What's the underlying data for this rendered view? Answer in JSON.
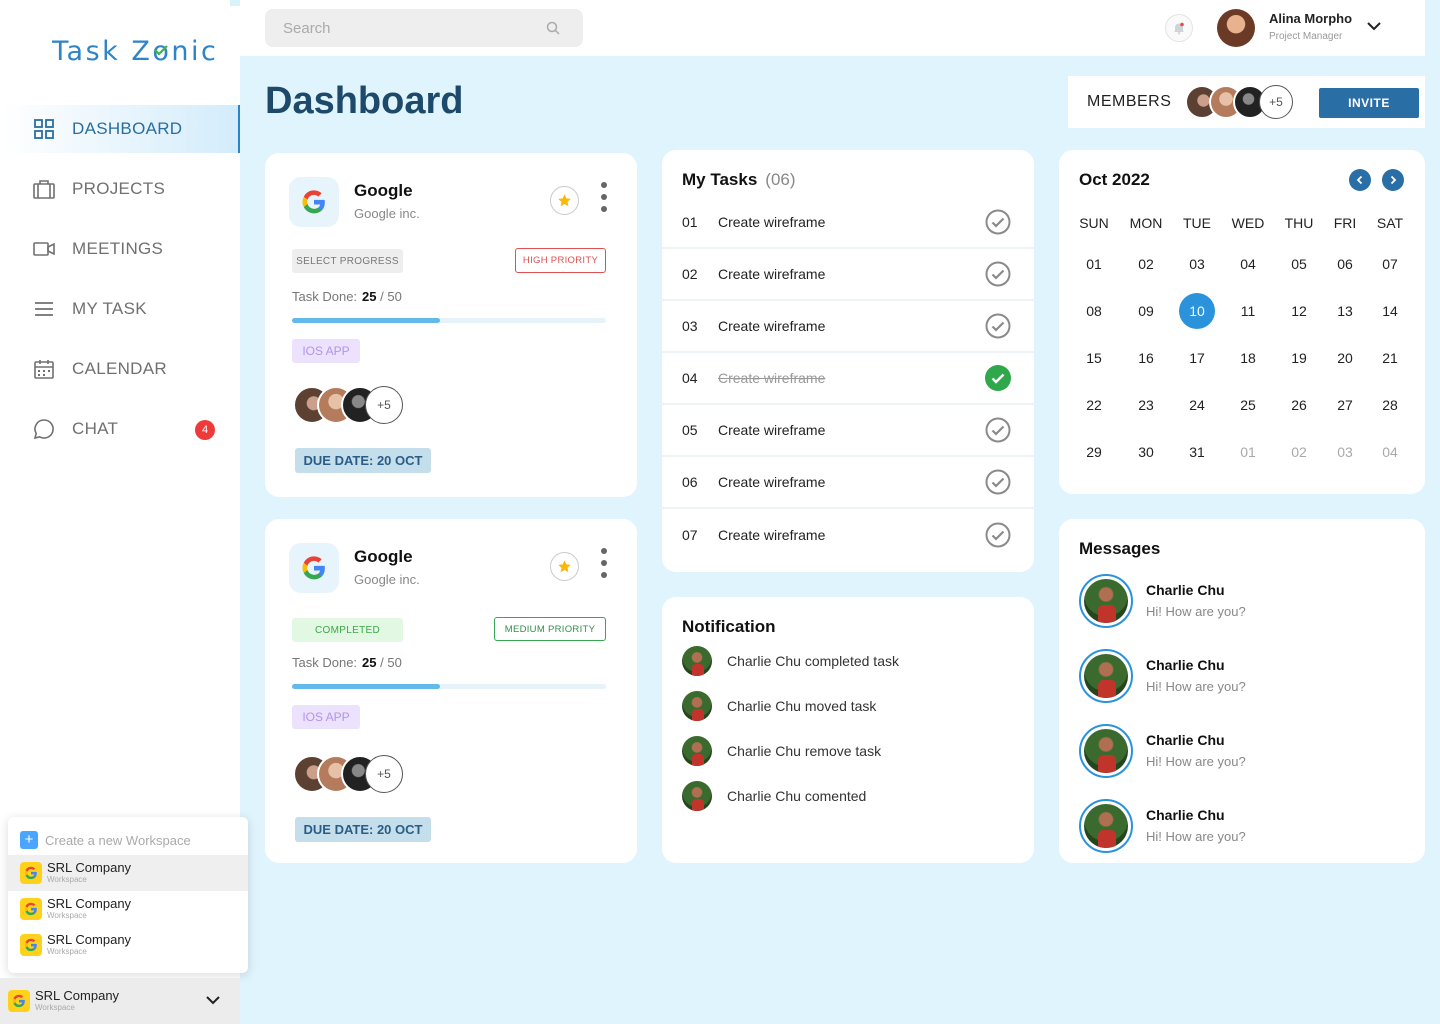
{
  "app": {
    "name": "TaskZonic"
  },
  "sidebar": {
    "items": [
      {
        "label": "DASHBOARD",
        "icon": "grid-icon",
        "active": true
      },
      {
        "label": "PROJECTS",
        "icon": "briefcase-icon"
      },
      {
        "label": "MEETINGS",
        "icon": "video-icon"
      },
      {
        "label": "MY TASK",
        "icon": "list-icon"
      },
      {
        "label": "CALENDAR",
        "icon": "calendar-icon"
      },
      {
        "label": "CHAT",
        "icon": "chat-icon",
        "badge": "4"
      }
    ]
  },
  "workspace": {
    "create_label": "Create a new Workspace",
    "items": [
      {
        "name": "SRL Company",
        "sub": "Workspace"
      },
      {
        "name": "SRL Company",
        "sub": "Workspace"
      },
      {
        "name": "SRL Company",
        "sub": "Workspace"
      }
    ],
    "current": {
      "name": "SRL Company",
      "sub": "Workspace"
    }
  },
  "topbar": {
    "search_placeholder": "Search",
    "user": {
      "name": "Alina Morpho",
      "role": "Project Manager"
    }
  },
  "page": {
    "title": "Dashboard"
  },
  "members": {
    "label": "MEMBERS",
    "more": "+5",
    "invite_label": "INVITE"
  },
  "projects": [
    {
      "name": "Google",
      "company": "Google inc.",
      "status": "SELECT PROGRESS",
      "priority": "HIGH PRIORITY",
      "task_label": "Task Done:",
      "done": "25",
      "total": "/ 50",
      "progress": 0.47,
      "tag": "IOS APP",
      "more": "+5",
      "due": "DUE DATE: 20 OCT"
    },
    {
      "name": "Google",
      "company": "Google inc.",
      "status": "COMPLETED",
      "priority": "MEDIUM PRIORITY",
      "task_label": "Task Done:",
      "done": "25",
      "total": "/ 50",
      "progress": 0.47,
      "tag": "IOS APP",
      "more": "+5",
      "due": "DUE DATE: 20 OCT"
    }
  ],
  "tasks": {
    "title": "My Tasks",
    "count": "(06)",
    "items": [
      {
        "num": "01",
        "text": "Create wireframe",
        "done": false
      },
      {
        "num": "02",
        "text": "Create wireframe",
        "done": false
      },
      {
        "num": "03",
        "text": "Create wireframe",
        "done": false
      },
      {
        "num": "04",
        "text": "Create wireframe",
        "done": true
      },
      {
        "num": "05",
        "text": "Create wireframe",
        "done": false
      },
      {
        "num": "06",
        "text": "Create wireframe",
        "done": false
      },
      {
        "num": "07",
        "text": "Create wireframe",
        "done": false
      }
    ]
  },
  "notifications": {
    "title": "Notification",
    "items": [
      {
        "name": "Charlie Chu",
        "action": "completed task"
      },
      {
        "name": "Charlie Chu",
        "action": "moved task"
      },
      {
        "name": "Charlie Chu",
        "action": "remove task"
      },
      {
        "name": "Charlie Chu",
        "action": "comented"
      }
    ]
  },
  "calendar": {
    "title": "Oct 2022",
    "weekdays": [
      "SUN",
      "MON",
      "TUE",
      "WED",
      "THU",
      "FRI",
      "SAT"
    ],
    "weeks": [
      [
        "01",
        "02",
        "03",
        "04",
        "05",
        "06",
        "07"
      ],
      [
        "08",
        "09",
        "10",
        "11",
        "12",
        "13",
        "14"
      ],
      [
        "15",
        "16",
        "17",
        "18",
        "19",
        "20",
        "21"
      ],
      [
        "22",
        "23",
        "24",
        "25",
        "26",
        "27",
        "28"
      ],
      [
        "29",
        "30",
        "31",
        "01",
        "02",
        "03",
        "04"
      ]
    ],
    "selected": "10",
    "outside_from_index": 31
  },
  "messages": {
    "title": "Messages",
    "items": [
      {
        "name": "Charlie Chu",
        "text": "Hi! How are you?"
      },
      {
        "name": "Charlie Chu",
        "text": "Hi! How are you?"
      },
      {
        "name": "Charlie Chu",
        "text": "Hi! How are you?"
      },
      {
        "name": "Charlie Chu",
        "text": "Hi! How are you?"
      }
    ]
  },
  "colors": {
    "accent": "#2a6ea6",
    "brand": "#2d84c8",
    "success": "#2ea84a",
    "danger": "#ef3a3a"
  }
}
